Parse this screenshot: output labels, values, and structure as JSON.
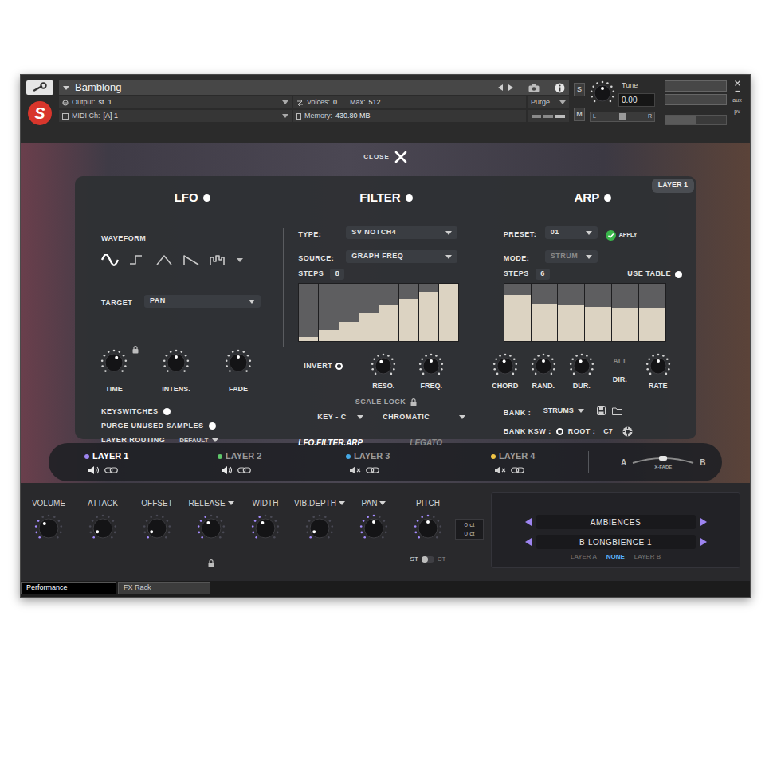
{
  "header": {
    "logo": "S",
    "instrument": "Bamblong",
    "output_label": "Output:",
    "output": "st. 1",
    "voices_label": "Voices:",
    "voices": "0",
    "max_label": "Max:",
    "max": "512",
    "midi_label": "MIDI Ch:",
    "midi": "[A] 1",
    "memory_label": "Memory:",
    "memory": "430.80 MB",
    "purge": "Purge",
    "solo": "S",
    "mute": "M",
    "tune_label": "Tune",
    "tune": "0.00",
    "tune_level": 0.5,
    "pan_left": "L",
    "pan_right": "R",
    "pan_level": 0.5,
    "volume_level": 0.5,
    "aux": "aux",
    "pv": "pv"
  },
  "close": {
    "label": "CLOSE"
  },
  "layer_badge": "LAYER 1",
  "lfo": {
    "title": "LFO",
    "on": true,
    "waveform_label": "WAVEFORM",
    "waveforms": [
      {
        "kind": "sine",
        "selected": true
      },
      {
        "kind": "square",
        "selected": false
      },
      {
        "kind": "triangle",
        "selected": false
      },
      {
        "kind": "saw",
        "selected": false
      },
      {
        "kind": "random",
        "selected": false
      }
    ],
    "target_label": "TARGET",
    "target": "PAN",
    "knobs": [
      {
        "label": "TIME",
        "level": 0.6,
        "lock": true
      },
      {
        "label": "INTENS.",
        "level": 0.5,
        "lock": false
      },
      {
        "label": "FADE",
        "level": 0.5,
        "lock": false
      }
    ],
    "toggles": [
      {
        "label": "KEYSWITCHES",
        "on": true
      },
      {
        "label": "PURGE UNUSED SAMPLES",
        "on": true
      }
    ],
    "routing_label": "LAYER ROUTING",
    "routing": "DEFAULT"
  },
  "filter": {
    "title": "FILTER",
    "on": true,
    "type_label": "TYPE:",
    "type": "SV NOTCH4",
    "source_label": "SOURCE:",
    "source": "GRAPH FREQ",
    "steps_label": "STEPS",
    "steps": "8",
    "values": [
      0.07,
      0.2,
      0.34,
      0.48,
      0.62,
      0.74,
      0.86,
      0.98
    ],
    "invert": {
      "label": "INVERT",
      "on": false
    },
    "knobs": [
      {
        "label": "RESO.",
        "level": 0.4
      },
      {
        "label": "FREQ.",
        "level": 0.5
      }
    ],
    "scale_lock_label": "SCALE LOCK",
    "key": "KEY - C",
    "scale": "CHROMATIC"
  },
  "arp": {
    "title": "ARP",
    "on": true,
    "preset_label": "PRESET:",
    "preset": "01",
    "apply": "APPLY",
    "mode_label": "MODE:",
    "mode": "STRUM",
    "mode_disabled": true,
    "steps_label": "STEPS",
    "steps": "6",
    "use_table": {
      "label": "USE TABLE",
      "on": true
    },
    "values": [
      0.8,
      0.64,
      0.62,
      0.6,
      0.58,
      0.57
    ],
    "knobs": [
      {
        "kind": "knob",
        "label": "CHORD",
        "level": 0.45
      },
      {
        "kind": "knob",
        "label": "RAND.",
        "level": 0.5
      },
      {
        "kind": "knob",
        "label": "DUR.",
        "level": 0.45
      },
      {
        "kind": "switch",
        "top": "ALT",
        "label": "DIR."
      },
      {
        "kind": "knob",
        "label": "RATE",
        "level": 0.5
      }
    ],
    "bank_label": "BANK :",
    "bank": "STRUMS",
    "bank_ksw_label": "BANK KSW :",
    "bank_ksw_on": false,
    "root_label": "ROOT :",
    "root": "C7"
  },
  "panel_tabs": [
    {
      "label": "LFO.FILTER.ARP",
      "selected": true
    },
    {
      "label": "LEGATO",
      "selected": false
    }
  ],
  "layers": [
    {
      "label": "LAYER 1",
      "color": "#9d84f0",
      "selected": true,
      "muted": false
    },
    {
      "label": "LAYER 2",
      "color": "#5fc76a",
      "selected": false,
      "muted": false
    },
    {
      "label": "LAYER 3",
      "color": "#45a9e6",
      "selected": false,
      "muted": true
    },
    {
      "label": "LAYER 4",
      "color": "#f0c445",
      "selected": false,
      "muted": true
    }
  ],
  "xfade": {
    "a": "A",
    "b": "B",
    "label": "X-FADE",
    "level": 0.5
  },
  "controls": [
    {
      "label": "VOLUME",
      "level": 0.35,
      "menu": false,
      "lock": false
    },
    {
      "label": "ATTACK",
      "level": 0.05,
      "menu": false,
      "lock": false
    },
    {
      "label": "OFFSET",
      "level": 0.05,
      "menu": false,
      "lock": false
    },
    {
      "label": "RELEASE",
      "level": 0.4,
      "menu": true,
      "lock": true
    },
    {
      "label": "WIDTH",
      "level": 0.4,
      "menu": false,
      "lock": false
    },
    {
      "label": "VIB.DEPTH",
      "level": 0.05,
      "menu": true,
      "lock": false
    },
    {
      "label": "PAN",
      "level": 0.5,
      "menu": true,
      "lock": false
    },
    {
      "label": "PITCH",
      "level": 0.5,
      "menu": false,
      "lock": false
    }
  ],
  "pitch": {
    "readings": [
      "0 ct",
      "0 ct"
    ],
    "modes": [
      {
        "label": "ST",
        "selected": true
      },
      {
        "label": "CT",
        "selected": false
      }
    ]
  },
  "browser": {
    "category": "AMBIENCES",
    "patch": "B-LONGBIENCE 1",
    "targets": [
      {
        "label": "LAYER A",
        "selected": false
      },
      {
        "label": "NONE",
        "selected": true
      },
      {
        "label": "LAYER B",
        "selected": false
      }
    ]
  },
  "tabs": [
    {
      "label": "Performance",
      "selected": true
    },
    {
      "label": "FX Rack",
      "selected": false
    }
  ]
}
